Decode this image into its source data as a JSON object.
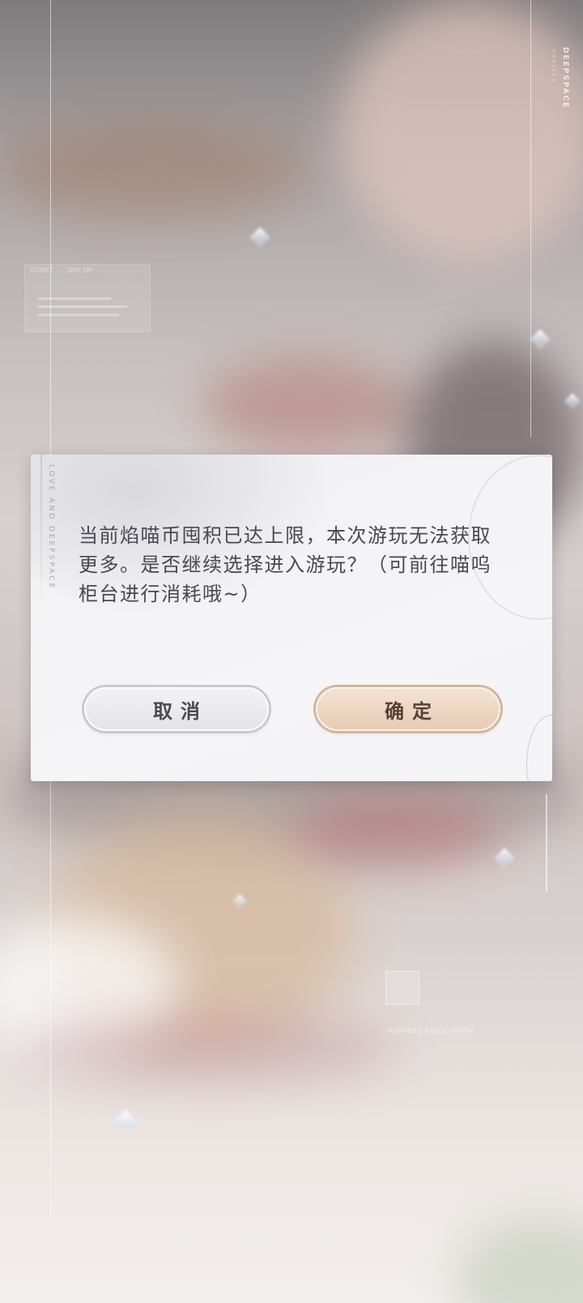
{
  "background": {
    "brand_vertical": "DEEPSPACE",
    "brand_vertical_sub": "HUNTERS",
    "panel_chip_1": "COMET",
    "panel_chip_2": "ONE UP",
    "panel_caption": "HUNTERS ASSOCIATION"
  },
  "dialog": {
    "side_text": "LOVE AND DEEPSPACE",
    "message": "当前焰喵币囤积已达上限，本次游玩无法获取更多。是否继续选择进入游玩？（可前往喵呜柜台进行消耗哦~）",
    "cancel_label": "取消",
    "confirm_label": "确定"
  },
  "colors": {
    "dialog_bg": "#f4f4f7",
    "text": "#4a4850",
    "confirm_accent": "#e6cab2",
    "cancel_accent": "#e3e3e6"
  }
}
